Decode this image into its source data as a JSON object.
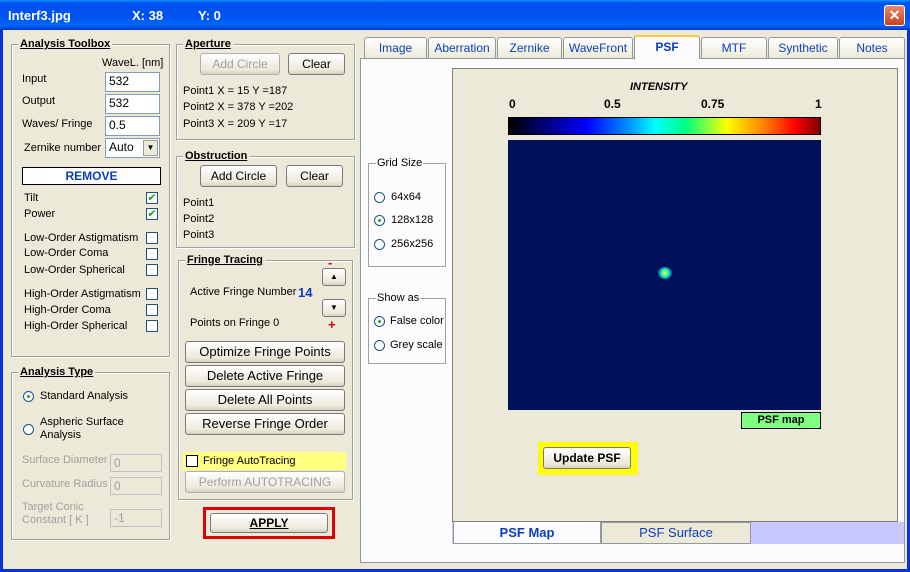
{
  "titlebar": {
    "title": "Interf3.jpg",
    "x_label": "X: 38",
    "y_label": "Y: 0",
    "close_glyph": "✕"
  },
  "toolbox": {
    "title": "Analysis Toolbox",
    "wavel_header": "WaveL. [nm]",
    "input_label": "Input",
    "input_value": "532",
    "output_label": "Output",
    "output_value": "532",
    "waves_label": "Waves/ Fringe",
    "waves_value": "0.5",
    "zernike_label": "Zernike number",
    "zernike_value": "Auto",
    "remove_label": "REMOVE",
    "tilt": "Tilt",
    "power": "Power",
    "low_astig": "Low-Order  Astigmatism",
    "low_coma": "Low-Order  Coma",
    "low_sph": "Low-Order  Spherical",
    "high_astig": "High-Order  Astigmatism",
    "high_coma": "High-Order  Coma",
    "high_sph": "High-Order  Spherical",
    "checks": {
      "tilt": true,
      "power": true,
      "low_astig": false,
      "low_coma": false,
      "low_sph": false,
      "high_astig": false,
      "high_coma": false,
      "high_sph": false
    }
  },
  "analysis_type": {
    "title": "Analysis Type",
    "standard": "Standard  Analysis",
    "aspheric_line1": "Aspheric  Surface",
    "aspheric_line2": "Analysis",
    "surface_diameter": "Surface Diameter",
    "surface_diameter_value": "0",
    "curvature_radius": "Curvature Radius",
    "curvature_radius_value": "0",
    "target_conic_line1": "Target Conic",
    "target_conic_line2": "Constant [ K ]",
    "target_conic_value": "-1"
  },
  "aperture": {
    "title": "Aperture",
    "add_circle": "Add Circle",
    "clear": "Clear",
    "p1": "Point1  X =    15   Y =187",
    "p2": "Point2  X =   378   Y =202",
    "p3": "Point3  X =   209   Y =17"
  },
  "obstruction": {
    "title": "Obstruction",
    "add_circle": "Add Circle",
    "clear": "Clear",
    "p1": "Point1",
    "p2": "Point2",
    "p3": "Point3"
  },
  "fringe": {
    "title": "Fringe Tracing",
    "active_label": "Active Fringe Number",
    "active_value": "14",
    "points_label": "Points on  Fringe 0",
    "minus": "-",
    "plus": "+",
    "optimize": "Optimize Fringe Points",
    "delete_active": "Delete Active Fringe",
    "delete_all": "Delete  All  Points",
    "reverse": "Reverse  Fringe Order",
    "autotracing": "Fringe AutoTracing",
    "perform": "Perform  AUTOTRACING"
  },
  "apply_label": "APPLY",
  "tabs": [
    "Image",
    "Aberration",
    "Zernike",
    "WaveFront",
    "PSF",
    "MTF",
    "Synthetic",
    "Notes"
  ],
  "grid_size": {
    "title": "Grid Size",
    "o1": "64x64",
    "o2": "128x128",
    "o3": "256x256",
    "selected": "128x128"
  },
  "show_as": {
    "title": "Show as",
    "o1": "False color",
    "o2": "Grey scale",
    "selected": "False color"
  },
  "psf": {
    "intensity_label": "INTENSITY",
    "scale_ticks": [
      "0",
      "0.5",
      "0.75",
      "1"
    ],
    "map_label": "PSF map",
    "update_button": "Update PSF",
    "bottom_tab_map": "PSF  Map",
    "bottom_tab_surface": "PSF Surface"
  },
  "colors": {
    "accent_blue": "#0b3ebc",
    "highlight_yellow": "#ffff00",
    "apply_red": "#e00000",
    "psf_bg": "#00105a",
    "psf_map_green": "#80ff80"
  }
}
